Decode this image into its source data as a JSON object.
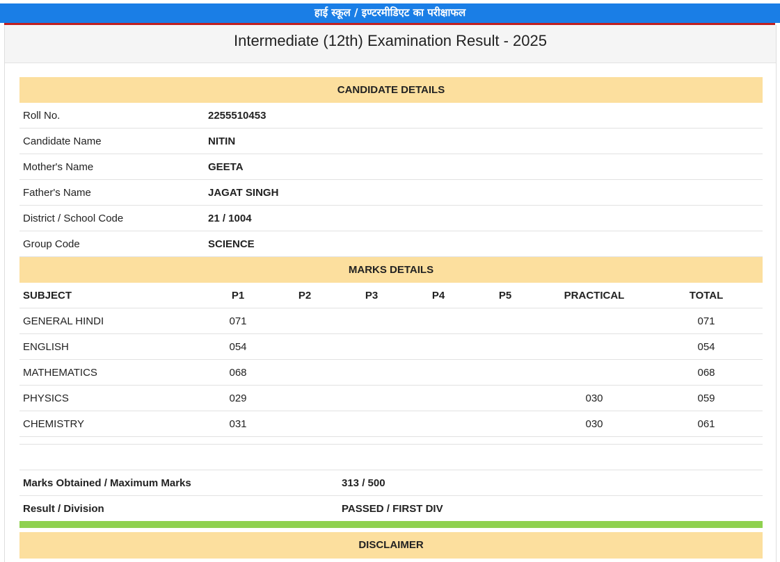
{
  "banner": {
    "text": "हाई स्कूल / इण्टरमीडिएट का परीक्षाफल"
  },
  "page_title": "Intermediate (12th) Examination Result - 2025",
  "candidate": {
    "heading": "CANDIDATE DETAILS",
    "rows": [
      {
        "label": "Roll No.",
        "value": "2255510453"
      },
      {
        "label": "Candidate Name",
        "value": "NITIN"
      },
      {
        "label": "Mother's Name",
        "value": "GEETA"
      },
      {
        "label": "Father's Name",
        "value": "JAGAT SINGH"
      },
      {
        "label": "District / School Code",
        "value": "21 / 1004"
      },
      {
        "label": "Group Code",
        "value": "SCIENCE"
      }
    ]
  },
  "marks": {
    "heading": "MARKS DETAILS",
    "columns": [
      "SUBJECT",
      "P1",
      "P2",
      "P3",
      "P4",
      "P5",
      "PRACTICAL",
      "TOTAL"
    ],
    "rows": [
      [
        "GENERAL HINDI",
        "071",
        "",
        "",
        "",
        "",
        "",
        "071"
      ],
      [
        "ENGLISH",
        "054",
        "",
        "",
        "",
        "",
        "",
        "054"
      ],
      [
        "MATHEMATICS",
        "068",
        "",
        "",
        "",
        "",
        "",
        "068"
      ],
      [
        "PHYSICS",
        "029",
        "",
        "",
        "",
        "",
        "030",
        "059"
      ],
      [
        "CHEMISTRY",
        "031",
        "",
        "",
        "",
        "",
        "030",
        "061"
      ]
    ]
  },
  "summary": {
    "rows": [
      {
        "label": "Marks Obtained / Maximum Marks",
        "value": "313 / 500"
      },
      {
        "label": "Result / Division",
        "value": "PASSED / FIRST DIV"
      }
    ]
  },
  "disclaimer": {
    "heading": "DISCLAIMER"
  },
  "colors": {
    "banner": "#1a7ee6",
    "section_header": "#fcdf9e",
    "result_bar": "#8fd14f",
    "accent_line": "#c02020"
  }
}
